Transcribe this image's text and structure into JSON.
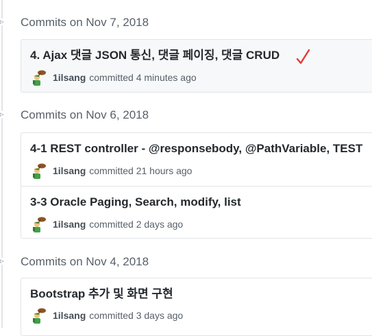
{
  "groups": [
    {
      "title": "Commits on Nov 7, 2018",
      "commits": [
        {
          "message": "4. Ajax 댓글 JSON 통신, 댓글 페이징, 댓글 CRUD",
          "author": "1ilsang",
          "action": "committed",
          "time": "4 minutes ago"
        }
      ]
    },
    {
      "title": "Commits on Nov 6, 2018",
      "commits": [
        {
          "message": "4-1 REST controller - @responsebody, @PathVariable, TEST",
          "author": "1ilsang",
          "action": "committed",
          "time": "21 hours ago"
        },
        {
          "message": "3-3 Oracle Paging, Search, modify, list",
          "author": "1ilsang",
          "action": "committed",
          "time": "2 days ago"
        }
      ]
    },
    {
      "title": "Commits on Nov 4, 2018",
      "commits": [
        {
          "message": "Bootstrap 추가 및 화면 구현",
          "author": "1ilsang",
          "action": "committed",
          "time": "3 days ago"
        }
      ]
    }
  ],
  "icons": {
    "group_marker": "commit-node-icon",
    "avatar": "user-avatar-icon",
    "annotation": "red-checkmark-icon"
  },
  "colors": {
    "annotation": "#e53935",
    "highlight_bg": "#f6f8fa",
    "border": "#e1e4e8"
  }
}
